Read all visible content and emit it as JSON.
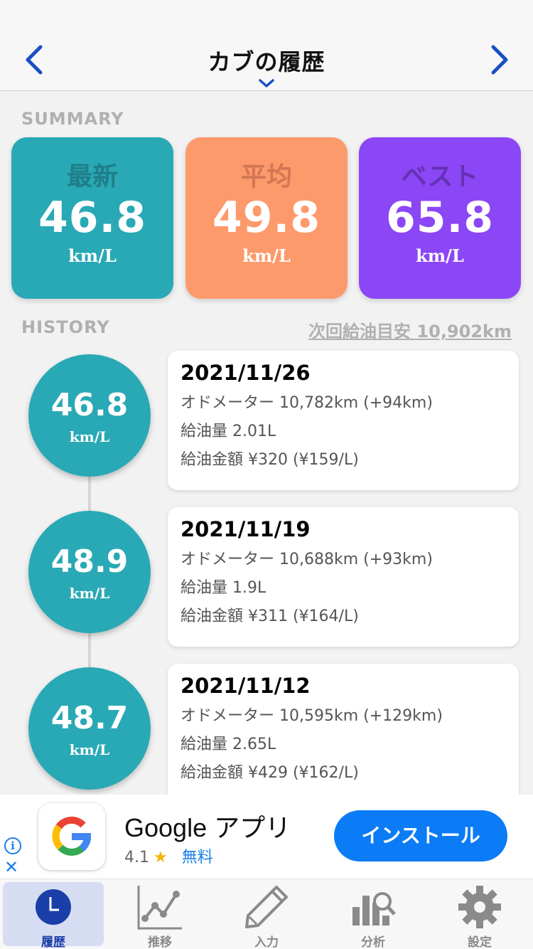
{
  "header": {
    "title": "カブの履歴",
    "prev_icon": "chevron-left-icon",
    "next_icon": "chevron-right-icon",
    "accent": "#1a4fc4"
  },
  "summary": {
    "section_label": "SUMMARY",
    "cards": [
      {
        "label": "最新",
        "value": "46.8",
        "unit": "km/L",
        "color": "#29a9b5",
        "label_color": "#1f7f88"
      },
      {
        "label": "平均",
        "value": "49.8",
        "unit": "km/L",
        "color": "#fd9a6b",
        "label_color": "#d27754"
      },
      {
        "label": "ベスト",
        "value": "65.8",
        "unit": "km/L",
        "color": "#8b46f5",
        "label_color": "#6431b5"
      }
    ]
  },
  "history": {
    "section_label": "HISTORY",
    "next_refuel": "次回給油目安 10,902km",
    "entries": [
      {
        "value": "46.8",
        "unit": "km/L",
        "date": "2021/11/26",
        "odometer": "オドメーター 10,782km (+94km)",
        "fuel": "給油量 2.01L",
        "cost": "給油金額 ¥320 (¥159/L)"
      },
      {
        "value": "48.9",
        "unit": "km/L",
        "date": "2021/11/19",
        "odometer": "オドメーター 10,688km (+93km)",
        "fuel": "給油量 1.9L",
        "cost": "給油金額 ¥311 (¥164/L)"
      },
      {
        "value": "48.7",
        "unit": "km/L",
        "date": "2021/11/12",
        "odometer": "オドメーター 10,595km (+129km)",
        "fuel": "給油量 2.65L",
        "cost": "給油金額 ¥429 (¥162/L)"
      }
    ]
  },
  "ad": {
    "app_name": "Google アプリ",
    "rating": "4.1",
    "price": "無料",
    "install_label": "インストール",
    "info_icon": "info-icon",
    "close_icon": "close-icon"
  },
  "tabs": [
    {
      "label": "履歴",
      "icon": "clock-icon",
      "active": true
    },
    {
      "label": "推移",
      "icon": "line-chart-icon",
      "active": false
    },
    {
      "label": "入力",
      "icon": "pencil-icon",
      "active": false
    },
    {
      "label": "分析",
      "icon": "bar-chart-search-icon",
      "active": false
    },
    {
      "label": "設定",
      "icon": "gear-icon",
      "active": false
    }
  ]
}
